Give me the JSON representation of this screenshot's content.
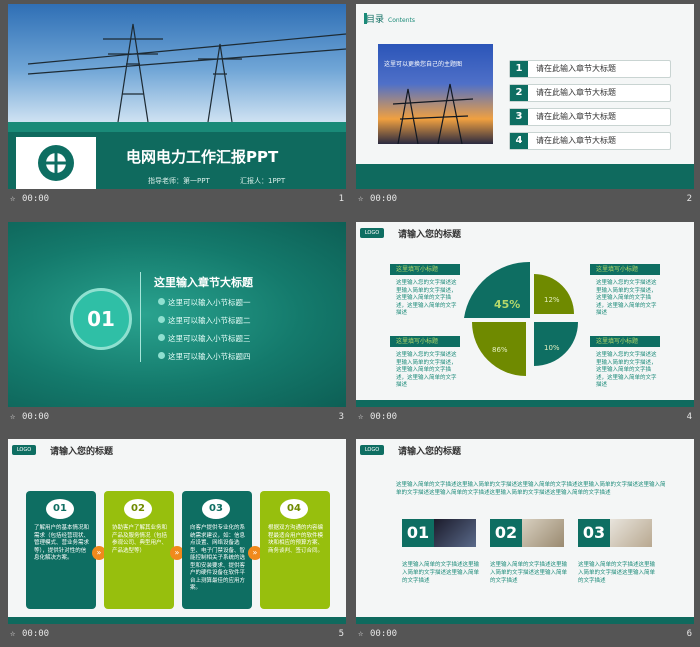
{
  "colors": {
    "teal": "#0e6e62",
    "teal_light": "#1a8a78",
    "lime": "#97bf0d",
    "olive": "#6f8a00",
    "orange": "#f08a1c",
    "background": "#555555"
  },
  "slides": [
    {
      "number": "1",
      "time": "00:00",
      "title": "电网电力工作汇报PPT",
      "instructor_label": "指导老师：第一PPT",
      "reporter_label": "汇报人：1PPT",
      "logo_text": "STATE GRID CORPORATION OF CHINA"
    },
    {
      "number": "2",
      "time": "00:00",
      "header": "目录",
      "header_sub": "Contents",
      "photo_caption": "这里可以更换您自己的主题图",
      "items": [
        {
          "num": "1",
          "label": "请在此输入章节大标题"
        },
        {
          "num": "2",
          "label": "请在此输入章节大标题"
        },
        {
          "num": "3",
          "label": "请在此输入章节大标题"
        },
        {
          "num": "4",
          "label": "请在此输入章节大标题"
        }
      ]
    },
    {
      "number": "3",
      "time": "00:00",
      "section_num": "01",
      "title": "这里输入章节大标题",
      "subs": [
        "这里可以输入小节标题一",
        "这里可以输入小节标题二",
        "这里可以输入小节标题三",
        "这里可以输入小节标题四"
      ]
    },
    {
      "number": "4",
      "time": "00:00",
      "logo": "LOGO",
      "title": "请输入您的标题",
      "tags": [
        "这里填写小标题",
        "这里填写小标题",
        "这里填写小标题",
        "这里填写小标题"
      ],
      "body": "这里输入您的文字描述这里输入简单的文字描述，这里输入简单的文字描述，这里输入简单的文字描述",
      "pie_labels": [
        "45%",
        "12%",
        "86%",
        "10%"
      ]
    },
    {
      "number": "5",
      "time": "00:00",
      "logo": "LOGO",
      "title": "请输入您的标题",
      "cards": [
        {
          "num": "01",
          "text": "了解用户的基本情况和需求（包括经营现状、管理模式、营业务需求等），提供针对性的信息化解决方案。"
        },
        {
          "num": "02",
          "text": "协助客户了解其业务和产品及服务情况（包括参观公司、典型用户、产品选型等）"
        },
        {
          "num": "03",
          "text": "向客户提供专业化的系统需求建议，如：信息点设置、网络设备选型、电子门禁设备、智能控制相关子系统的选型和安装要求、提供客户的硬件设备在软件平台上测算最佳的应用方案。"
        },
        {
          "num": "04",
          "text": "根据双方沟通的内容编程最适合用户的软件模块和相应的预算方案、商务谈判、签订合同。"
        }
      ]
    },
    {
      "number": "6",
      "time": "00:00",
      "logo": "LOGO",
      "title": "请输入您的标题",
      "intro": "这里输入简单的文字描述这里输入简单的文字描述这里输入简单的文字描述这里输入简单的文字描述这里输入简单的文字描述这里输入简单的文字描述这里输入简单的文字描述这里输入简单的文字描述",
      "items": [
        {
          "num": "01",
          "text": "这里输入简单的文字描述这里输入简单的文字描述这里输入简单的文字描述"
        },
        {
          "num": "02",
          "text": "这里输入简单的文字描述这里输入简单的文字描述这里输入简单的文字描述"
        },
        {
          "num": "03",
          "text": "这里输入简单的文字描述这里输入简单的文字描述这里输入简单的文字描述"
        }
      ]
    }
  ]
}
